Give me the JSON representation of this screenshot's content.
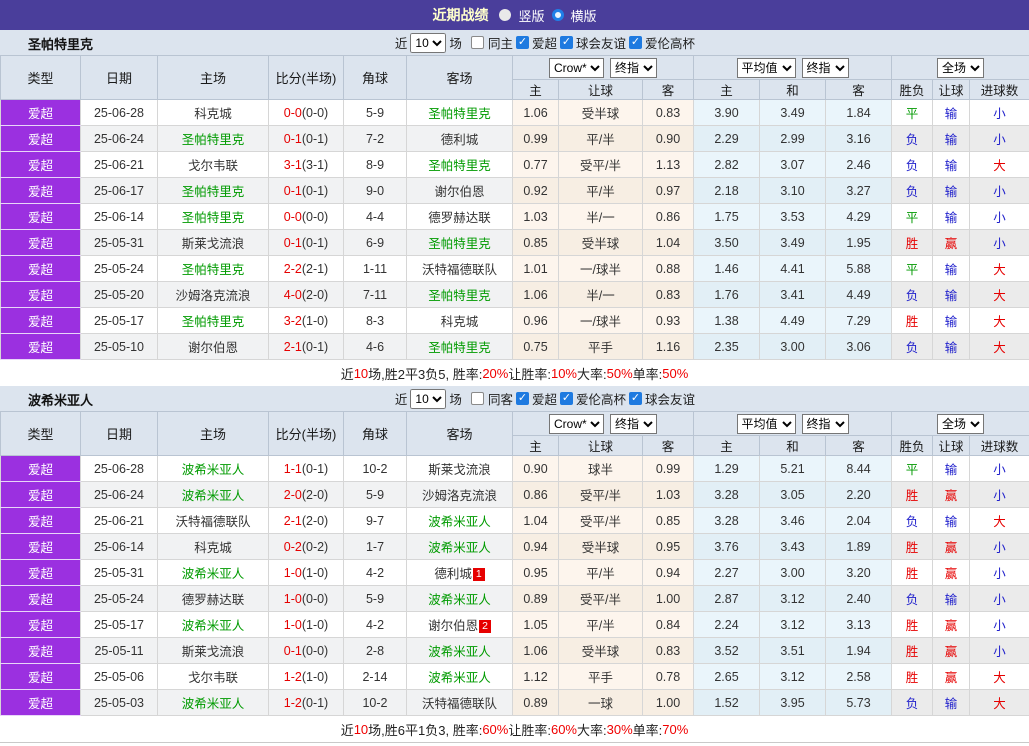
{
  "topbar": {
    "title": "近期战绩",
    "radios": [
      {
        "label": "竖版",
        "selected": true
      },
      {
        "label": "横版",
        "selected": false
      }
    ]
  },
  "table_header": {
    "main_cols": [
      "类型",
      "日期",
      "主场",
      "比分(半场)",
      "角球",
      "客场"
    ],
    "select_groups": [
      [
        "Crow*",
        "终指"
      ],
      [
        "平均值",
        "终指"
      ],
      [
        "全场"
      ]
    ],
    "sub_cols": [
      "主",
      "让球",
      "客",
      "主",
      "和",
      "客",
      "胜负",
      "让球",
      "进球数"
    ]
  },
  "sections": [
    {
      "team": "圣帕特里克",
      "filters": {
        "near_label": "近",
        "count": "10",
        "unit_label": "场",
        "checkboxes": [
          {
            "label": "同主",
            "checked": false
          },
          {
            "label": "爱超",
            "checked": true
          },
          {
            "label": "球会友谊",
            "checked": true
          },
          {
            "label": "爱伦高杯",
            "checked": true
          }
        ]
      },
      "rows": [
        {
          "type": "爱超",
          "date": "25-06-28",
          "home": "科克城",
          "home_focus": false,
          "score": "0-0",
          "half": "(0-0)",
          "corner": "5-9",
          "away": "圣帕特里克",
          "away_focus": true,
          "odds": [
            "1.06",
            "受半球",
            "0.83"
          ],
          "avg": [
            "3.90",
            "3.49",
            "1.84"
          ],
          "results": [
            "平",
            "输",
            "小"
          ]
        },
        {
          "type": "爱超",
          "date": "25-06-24",
          "home": "圣帕特里克",
          "home_focus": true,
          "score": "0-1",
          "half": "(0-1)",
          "corner": "7-2",
          "away": "德利城",
          "away_focus": false,
          "odds": [
            "0.99",
            "平/半",
            "0.90"
          ],
          "avg": [
            "2.29",
            "2.99",
            "3.16"
          ],
          "results": [
            "负",
            "输",
            "小"
          ]
        },
        {
          "type": "爱超",
          "date": "25-06-21",
          "home": "戈尔韦联",
          "home_focus": false,
          "score": "3-1",
          "half": "(3-1)",
          "corner": "8-9",
          "away": "圣帕特里克",
          "away_focus": true,
          "odds": [
            "0.77",
            "受平/半",
            "1.13"
          ],
          "avg": [
            "2.82",
            "3.07",
            "2.46"
          ],
          "results": [
            "负",
            "输",
            "大"
          ]
        },
        {
          "type": "爱超",
          "date": "25-06-17",
          "home": "圣帕特里克",
          "home_focus": true,
          "score": "0-1",
          "half": "(0-1)",
          "corner": "9-0",
          "away": "谢尔伯恩",
          "away_focus": false,
          "odds": [
            "0.92",
            "平/半",
            "0.97"
          ],
          "avg": [
            "2.18",
            "3.10",
            "3.27"
          ],
          "results": [
            "负",
            "输",
            "小"
          ]
        },
        {
          "type": "爱超",
          "date": "25-06-14",
          "home": "圣帕特里克",
          "home_focus": true,
          "score": "0-0",
          "half": "(0-0)",
          "corner": "4-4",
          "away": "德罗赫达联",
          "away_focus": false,
          "odds": [
            "1.03",
            "半/一",
            "0.86"
          ],
          "avg": [
            "1.75",
            "3.53",
            "4.29"
          ],
          "results": [
            "平",
            "输",
            "小"
          ]
        },
        {
          "type": "爱超",
          "date": "25-05-31",
          "home": "斯莱戈流浪",
          "home_focus": false,
          "score": "0-1",
          "half": "(0-1)",
          "corner": "6-9",
          "away": "圣帕特里克",
          "away_focus": true,
          "odds": [
            "0.85",
            "受半球",
            "1.04"
          ],
          "avg": [
            "3.50",
            "3.49",
            "1.95"
          ],
          "results": [
            "胜",
            "赢",
            "小"
          ]
        },
        {
          "type": "爱超",
          "date": "25-05-24",
          "home": "圣帕特里克",
          "home_focus": true,
          "score": "2-2",
          "half": "(2-1)",
          "corner": "1-11",
          "away": "沃特福德联队",
          "away_focus": false,
          "odds": [
            "1.01",
            "一/球半",
            "0.88"
          ],
          "avg": [
            "1.46",
            "4.41",
            "5.88"
          ],
          "results": [
            "平",
            "输",
            "大"
          ]
        },
        {
          "type": "爱超",
          "date": "25-05-20",
          "home": "沙姆洛克流浪",
          "home_focus": false,
          "score": "4-0",
          "half": "(2-0)",
          "corner": "7-11",
          "away": "圣帕特里克",
          "away_focus": true,
          "odds": [
            "1.06",
            "半/一",
            "0.83"
          ],
          "avg": [
            "1.76",
            "3.41",
            "4.49"
          ],
          "results": [
            "负",
            "输",
            "大"
          ]
        },
        {
          "type": "爱超",
          "date": "25-05-17",
          "home": "圣帕特里克",
          "home_focus": true,
          "score": "3-2",
          "half": "(1-0)",
          "corner": "8-3",
          "away": "科克城",
          "away_focus": false,
          "odds": [
            "0.96",
            "一/球半",
            "0.93"
          ],
          "avg": [
            "1.38",
            "4.49",
            "7.29"
          ],
          "results": [
            "胜",
            "输",
            "大"
          ]
        },
        {
          "type": "爱超",
          "date": "25-05-10",
          "home": "谢尔伯恩",
          "home_focus": false,
          "score": "2-1",
          "half": "(0-1)",
          "corner": "4-6",
          "away": "圣帕特里克",
          "away_focus": true,
          "odds": [
            "0.75",
            "平手",
            "1.16"
          ],
          "avg": [
            "2.35",
            "3.00",
            "3.06"
          ],
          "results": [
            "负",
            "输",
            "大"
          ]
        }
      ],
      "summary": [
        {
          "t": "近"
        },
        {
          "t": "10",
          "red": true
        },
        {
          "t": "场,胜2平3负5, 胜率:"
        },
        {
          "t": "20%",
          "red": true
        },
        {
          "t": " 让胜率:"
        },
        {
          "t": "10%",
          "red": true
        },
        {
          "t": " 大率:"
        },
        {
          "t": "50%",
          "red": true
        },
        {
          "t": " 单率:"
        },
        {
          "t": "50%",
          "red": true
        }
      ]
    },
    {
      "team": "波希米亚人",
      "filters": {
        "near_label": "近",
        "count": "10",
        "unit_label": "场",
        "checkboxes": [
          {
            "label": "同客",
            "checked": false
          },
          {
            "label": "爱超",
            "checked": true
          },
          {
            "label": "爱伦高杯",
            "checked": true
          },
          {
            "label": "球会友谊",
            "checked": true
          }
        ]
      },
      "rows": [
        {
          "type": "爱超",
          "date": "25-06-28",
          "home": "波希米亚人",
          "home_focus": true,
          "score": "1-1",
          "half": "(0-1)",
          "corner": "10-2",
          "away": "斯莱戈流浪",
          "away_focus": false,
          "odds": [
            "0.90",
            "球半",
            "0.99"
          ],
          "avg": [
            "1.29",
            "5.21",
            "8.44"
          ],
          "results": [
            "平",
            "输",
            "小"
          ]
        },
        {
          "type": "爱超",
          "date": "25-06-24",
          "home": "波希米亚人",
          "home_focus": true,
          "score": "2-0",
          "half": "(2-0)",
          "corner": "5-9",
          "away": "沙姆洛克流浪",
          "away_focus": false,
          "odds": [
            "0.86",
            "受平/半",
            "1.03"
          ],
          "avg": [
            "3.28",
            "3.05",
            "2.20"
          ],
          "results": [
            "胜",
            "赢",
            "小"
          ]
        },
        {
          "type": "爱超",
          "date": "25-06-21",
          "home": "沃特福德联队",
          "home_focus": false,
          "score": "2-1",
          "half": "(2-0)",
          "corner": "9-7",
          "away": "波希米亚人",
          "away_focus": true,
          "odds": [
            "1.04",
            "受平/半",
            "0.85"
          ],
          "avg": [
            "3.28",
            "3.46",
            "2.04"
          ],
          "results": [
            "负",
            "输",
            "大"
          ]
        },
        {
          "type": "爱超",
          "date": "25-06-14",
          "home": "科克城",
          "home_focus": false,
          "score": "0-2",
          "half": "(0-2)",
          "corner": "1-7",
          "away": "波希米亚人",
          "away_focus": true,
          "odds": [
            "0.94",
            "受半球",
            "0.95"
          ],
          "avg": [
            "3.76",
            "3.43",
            "1.89"
          ],
          "results": [
            "胜",
            "赢",
            "小"
          ]
        },
        {
          "type": "爱超",
          "date": "25-05-31",
          "home": "波希米亚人",
          "home_focus": true,
          "score": "1-0",
          "half": "(1-0)",
          "corner": "4-2",
          "away": "德利城",
          "away_focus": false,
          "away_badge": "1",
          "odds": [
            "0.95",
            "平/半",
            "0.94"
          ],
          "avg": [
            "2.27",
            "3.00",
            "3.20"
          ],
          "results": [
            "胜",
            "赢",
            "小"
          ]
        },
        {
          "type": "爱超",
          "date": "25-05-24",
          "home": "德罗赫达联",
          "home_focus": false,
          "score": "1-0",
          "half": "(0-0)",
          "corner": "5-9",
          "away": "波希米亚人",
          "away_focus": true,
          "odds": [
            "0.89",
            "受平/半",
            "1.00"
          ],
          "avg": [
            "2.87",
            "3.12",
            "2.40"
          ],
          "results": [
            "负",
            "输",
            "小"
          ]
        },
        {
          "type": "爱超",
          "date": "25-05-17",
          "home": "波希米亚人",
          "home_focus": true,
          "score": "1-0",
          "half": "(1-0)",
          "corner": "4-2",
          "away": "谢尔伯恩",
          "away_focus": false,
          "away_badge": "2",
          "odds": [
            "1.05",
            "平/半",
            "0.84"
          ],
          "avg": [
            "2.24",
            "3.12",
            "3.13"
          ],
          "results": [
            "胜",
            "赢",
            "小"
          ]
        },
        {
          "type": "爱超",
          "date": "25-05-11",
          "home": "斯莱戈流浪",
          "home_focus": false,
          "score": "0-1",
          "half": "(0-0)",
          "corner": "2-8",
          "away": "波希米亚人",
          "away_focus": true,
          "odds": [
            "1.06",
            "受半球",
            "0.83"
          ],
          "avg": [
            "3.52",
            "3.51",
            "1.94"
          ],
          "results": [
            "胜",
            "赢",
            "小"
          ]
        },
        {
          "type": "爱超",
          "date": "25-05-06",
          "home": "戈尔韦联",
          "home_focus": false,
          "score": "1-2",
          "half": "(1-0)",
          "corner": "2-14",
          "away": "波希米亚人",
          "away_focus": true,
          "odds": [
            "1.12",
            "平手",
            "0.78"
          ],
          "avg": [
            "2.65",
            "3.12",
            "2.58"
          ],
          "results": [
            "胜",
            "赢",
            "大"
          ]
        },
        {
          "type": "爱超",
          "date": "25-05-03",
          "home": "波希米亚人",
          "home_focus": true,
          "score": "1-2",
          "half": "(0-1)",
          "corner": "10-2",
          "away": "沃特福德联队",
          "away_focus": false,
          "odds": [
            "0.89",
            "一球",
            "1.00"
          ],
          "avg": [
            "1.52",
            "3.95",
            "5.73"
          ],
          "results": [
            "负",
            "输",
            "大"
          ]
        }
      ],
      "summary": [
        {
          "t": "近"
        },
        {
          "t": "10",
          "red": true
        },
        {
          "t": "场,胜6平1负3, 胜率:"
        },
        {
          "t": "60%",
          "red": true
        },
        {
          "t": " 让胜率:"
        },
        {
          "t": "60%",
          "red": true
        },
        {
          "t": " 大率:"
        },
        {
          "t": "30%",
          "red": true
        },
        {
          "t": " 单率:"
        },
        {
          "t": "70%",
          "red": true
        }
      ]
    }
  ],
  "colors": {
    "topbar_bg": "#4a3e9b",
    "title_text": "#ffffcc",
    "section_bar_bg": "#dce4ee",
    "type_cell_bg": "#9b30e0",
    "focus_team": "#009b00",
    "score_red": "#e60000",
    "win_red": "#e60000",
    "draw_green": "#009900",
    "lose_blue": "#2222cc",
    "odds_bg": "#fdf5ed",
    "avg_bg": "#eaf5fb"
  }
}
